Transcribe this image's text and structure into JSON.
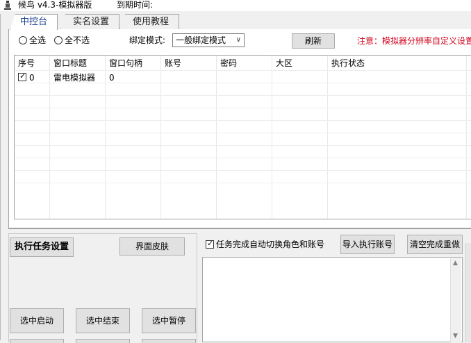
{
  "window": {
    "title": "候鸟 v4.3-模拟器版",
    "expiry_label": "到期时间:",
    "icon": "app-bird-icon"
  },
  "tabs": [
    {
      "label": "中控台",
      "active": true
    },
    {
      "label": "实名设置",
      "active": false
    },
    {
      "label": "使用教程",
      "active": false
    }
  ],
  "controls": {
    "select_all": "全选",
    "select_none": "全不选",
    "bind_mode_label": "绑定模式:",
    "bind_mode_value": "一般绑定模式",
    "refresh_button": "刷新",
    "notice": "注意：模拟器分辨率自定义设置"
  },
  "table": {
    "headers": [
      "序号",
      "窗口标题",
      "窗口句柄",
      "账号",
      "密码",
      "大区",
      "执行状态"
    ],
    "rows": [
      {
        "checked": true,
        "index": "0",
        "title": "雷电模拟器",
        "handle": "0",
        "account": "",
        "password": "",
        "region": "",
        "status": ""
      }
    ]
  },
  "bottom": {
    "exec_settings": "执行任务设置",
    "skin": "界面皮肤",
    "auto_switch_label": "任务完成自动切换角色和账号",
    "auto_switch_checked": true,
    "import_accounts": "导入执行账号",
    "clear_redo": "清空完成重做",
    "start_selected": "选中启动",
    "end_selected": "选中结束",
    "pause_selected": "选中暂停"
  },
  "colors": {
    "notice": "#d0021b",
    "active_tab": "#1a3f8f",
    "background": "#f0f0f0"
  }
}
